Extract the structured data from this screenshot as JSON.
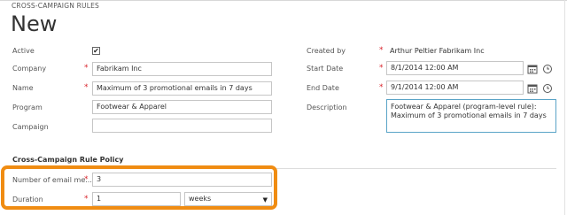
{
  "breadcrumb": "CROSS-CAMPAIGN RULES",
  "title": "New",
  "left_fields": {
    "active": {
      "label": "Active",
      "checked_mark": "✔"
    },
    "company": {
      "label": "Company",
      "required": "*",
      "value": "Fabrikam Inc"
    },
    "name": {
      "label": "Name",
      "required": "*",
      "value": "Maximum of 3 promotional emails in 7 days"
    },
    "program": {
      "label": "Program",
      "value": "Footwear & Apparel"
    },
    "campaign": {
      "label": "Campaign",
      "value": ""
    }
  },
  "right_fields": {
    "created_by": {
      "label": "Created by",
      "required": "*",
      "value": "Arthur Peltier Fabrikam Inc"
    },
    "start_date": {
      "label": "Start Date",
      "required": "*",
      "value": "8/1/2014 12:00 AM"
    },
    "end_date": {
      "label": "End Date",
      "required": "*",
      "value": "9/1/2014 12:00 AM"
    },
    "description": {
      "label": "Description",
      "value": "Footwear & Apparel (program-level rule): Maximum of 3 promotional emails in 7 days"
    }
  },
  "policy": {
    "section_title": "Cross-Campaign Rule Policy",
    "number_of_email": {
      "label": "Number of email me...",
      "required": "*",
      "value": "3"
    },
    "duration": {
      "label": "Duration",
      "required": "*",
      "value": "1",
      "unit": "weeks"
    }
  },
  "colors": {
    "highlight": "#f08c12",
    "required": "#d9242c",
    "focus_border": "#5aa4c7"
  }
}
